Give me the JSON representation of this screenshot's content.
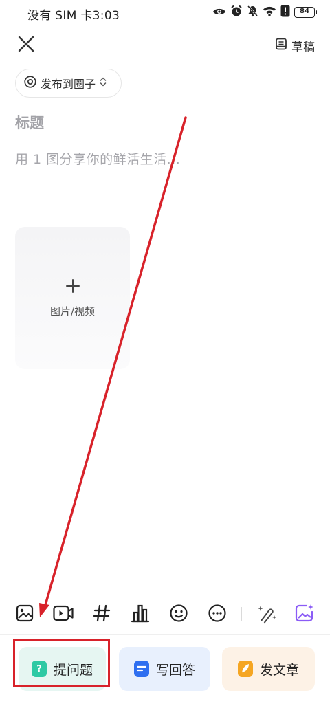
{
  "status_bar": {
    "carrier_time": "没有 SIM 卡3:03",
    "battery": "84",
    "icons": [
      "eye-icon",
      "alarm-icon",
      "mute-icon",
      "wifi-icon",
      "alert-icon",
      "battery-icon"
    ]
  },
  "header": {
    "close_icon": "close-icon",
    "draft_label": "草稿",
    "draft_icon": "draft-icon"
  },
  "circle_selector": {
    "label": "发布到圈子",
    "icon": "circle-target-icon",
    "chevron": "updown-chevron-icon"
  },
  "editor": {
    "title_placeholder": "标题",
    "body_placeholder": "用 1 图分享你的鲜活生活..."
  },
  "media": {
    "plus": "+",
    "label": "图片/视频"
  },
  "toolbar": {
    "items": [
      "image-icon",
      "video-icon",
      "hashtag-icon",
      "chart-icon",
      "emoji-icon",
      "more-icon",
      "ai-magic-icon",
      "ai-image-icon"
    ]
  },
  "actions": {
    "ask": {
      "label": "提问题",
      "icon_text": "?",
      "color": "#2ec9a4"
    },
    "answer": {
      "label": "写回答",
      "color": "#2f6ff0"
    },
    "article": {
      "label": "发文章",
      "color": "#f5a623"
    }
  },
  "colors": {
    "annotation_red": "#d8222a",
    "ai_purple": "#8b5cf6"
  }
}
